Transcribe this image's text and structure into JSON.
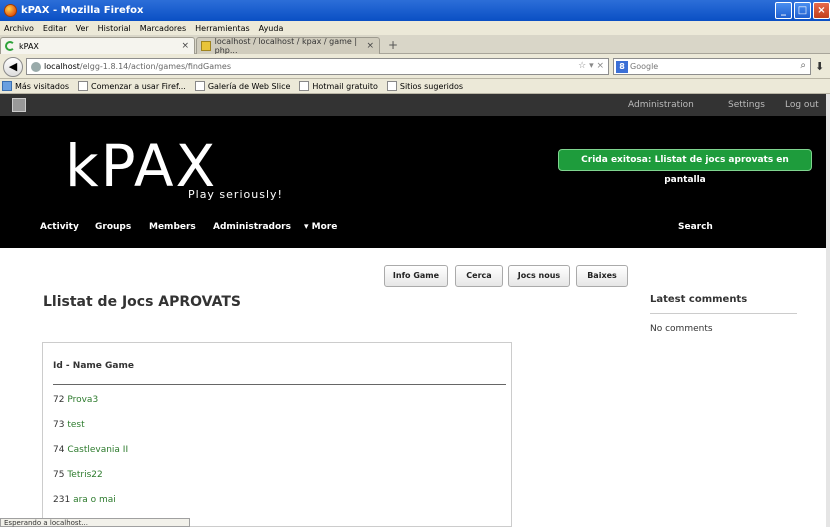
{
  "window": {
    "title": "kPAX - Mozilla Firefox"
  },
  "menu": [
    "Archivo",
    "Editar",
    "Ver",
    "Historial",
    "Marcadores",
    "Herramientas",
    "Ayuda"
  ],
  "tabs": [
    {
      "label": "kPAX",
      "close": "×"
    },
    {
      "label": "localhost / localhost / kpax / game | php...",
      "close": "×"
    }
  ],
  "newtab": "+",
  "address": {
    "host": "localhost",
    "path": "/elgg-1.8.14/action/games/findGames",
    "actions": "☆ ▾ ×"
  },
  "search": {
    "engine": "8",
    "placeholder": "Google"
  },
  "bookmarks": [
    "Más visitados",
    "Comenzar a usar Firef...",
    "Galería de Web Slice",
    "Hotmail gratuito",
    "Sitios sugeridos"
  ],
  "topbar": {
    "administration": "Administration",
    "settings": "Settings",
    "logout": "Log out"
  },
  "header": {
    "logo": "kPAX",
    "tagline": "Play seriously!",
    "message": "Crida exitosa: Llistat de jocs aprovats en pantalla"
  },
  "nav": {
    "activity": "Activity",
    "groups": "Groups",
    "members": "Members",
    "admins": "Administradors",
    "more": "▾ More",
    "search": "Search"
  },
  "subnav": [
    "Info Game",
    "Cerca",
    "Jocs nous",
    "Baixes"
  ],
  "main": {
    "title": "Llistat de Jocs APROVATS",
    "column_header": "Id - Name Game"
  },
  "games": [
    {
      "id": "72",
      "name": "Prova3"
    },
    {
      "id": "73",
      "name": "test"
    },
    {
      "id": "74",
      "name": "Castlevania II"
    },
    {
      "id": "75",
      "name": "Tetris22"
    },
    {
      "id": "231",
      "name": "ara o mai"
    }
  ],
  "sidebar": {
    "title": "Latest comments",
    "empty": "No comments"
  },
  "status": {
    "text": "Esperando a localhost..."
  },
  "colors": {
    "success": "#1e9c3c",
    "link": "#2d7b2d",
    "header_bg": "#000000",
    "topbar_bg": "#333333"
  }
}
